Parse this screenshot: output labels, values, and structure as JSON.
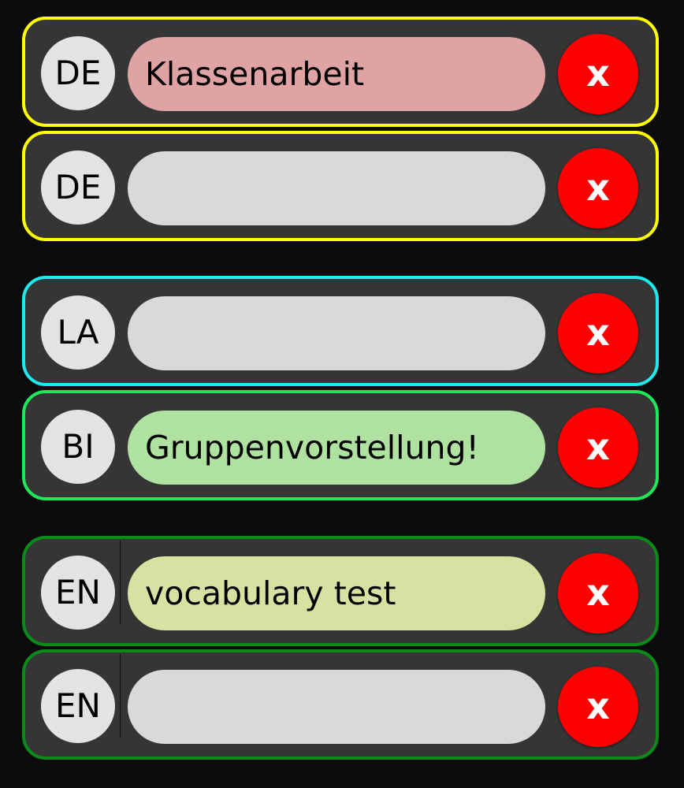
{
  "colors": {
    "page_background": "#0c0c0c",
    "card_background": "#353535",
    "subject_background": "#e3e3e3",
    "delete_button": "#ff0000",
    "empty_note": "#d9d9d9"
  },
  "rows": [
    {
      "subject": "DE",
      "note": "Klassenarbeit",
      "note_color": "#e0a3a3",
      "border_color": "#ffff00",
      "delete_label": "x"
    },
    {
      "subject": "DE",
      "note": "",
      "note_color": "#d9d9d9",
      "border_color": "#ffff00",
      "delete_label": "x"
    },
    {
      "subject": "LA",
      "note": "",
      "note_color": "#d9d9d9",
      "border_color": "#1ee8f0",
      "delete_label": "x"
    },
    {
      "subject": "BI",
      "note": "Gruppenvorstellung!",
      "note_color": "#afe2a1",
      "border_color": "#1ee85a",
      "delete_label": "x"
    },
    {
      "subject": "EN",
      "note": "vocabulary test",
      "note_color": "#d7e1a1",
      "border_color": "#0c8a1a",
      "delete_label": "x"
    },
    {
      "subject": "EN",
      "note": "",
      "note_color": "#d9d9d9",
      "border_color": "#0c8a1a",
      "delete_label": "x"
    }
  ]
}
